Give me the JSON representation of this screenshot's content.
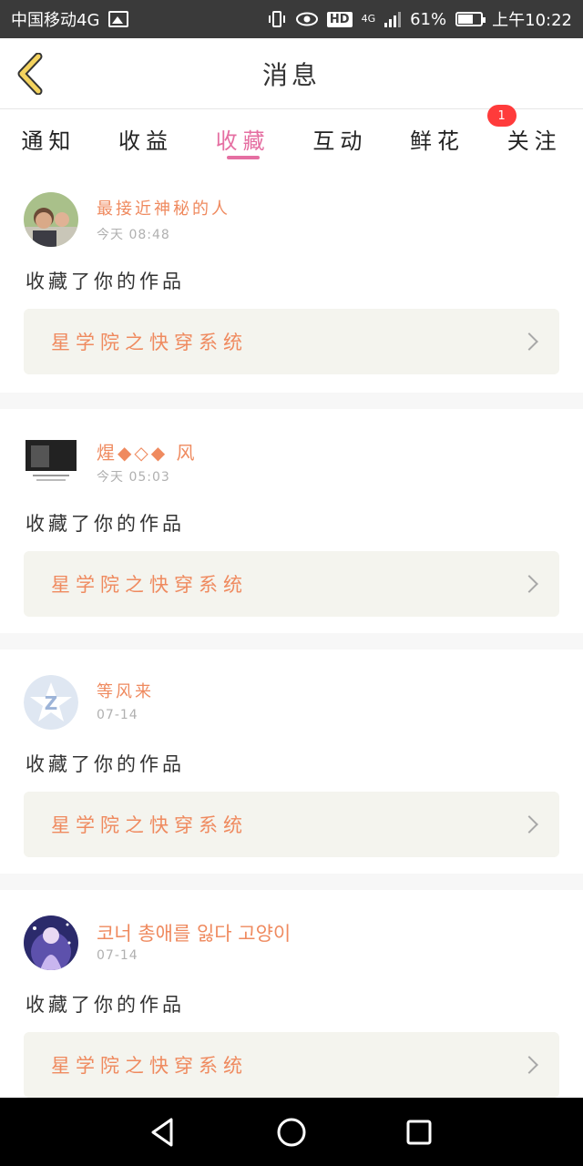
{
  "status_bar": {
    "carrier": "中国移动4G",
    "hd": "HD",
    "net": "4G",
    "battery": "61%",
    "time": "上午10:22"
  },
  "header": {
    "title": "消息",
    "back_icon": "chevron-left-icon"
  },
  "tabs": [
    {
      "label": "通知",
      "active": false
    },
    {
      "label": "收益",
      "active": false
    },
    {
      "label": "收藏",
      "active": true
    },
    {
      "label": "互动",
      "active": false
    },
    {
      "label": "鲜花",
      "active": false,
      "badge": "1"
    },
    {
      "label": "关注",
      "active": false
    }
  ],
  "messages": [
    {
      "user": "最接近神秘的人",
      "date": "今天 08:48",
      "action": "收藏了你的作品",
      "work": "星学院之快穿系统"
    },
    {
      "user": "煋◆◇◆ 风",
      "date": "今天 05:03",
      "action": "收藏了你的作品",
      "work": "星学院之快穿系统"
    },
    {
      "user": "等风来",
      "date": "07-14",
      "action": "收藏了你的作品",
      "work": "星学院之快穿系统"
    },
    {
      "user": "코너 총애를 잃다 고양이",
      "date": "07-14",
      "action": "收藏了你的作品",
      "work": "星学院之快穿系统"
    }
  ],
  "colors": {
    "accent_pink": "#e56fa2",
    "name_orange": "#ef8a5f",
    "badge_red": "#ff3b3b",
    "work_bg": "#f4f4ee"
  }
}
